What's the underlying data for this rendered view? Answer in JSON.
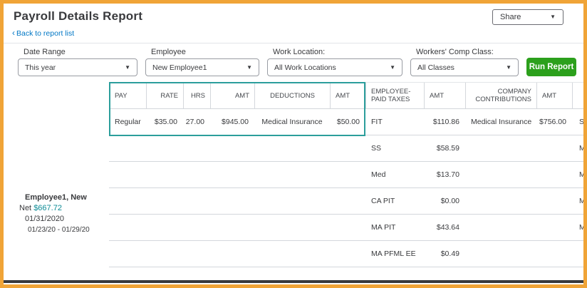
{
  "page": {
    "title": "Payroll Details Report",
    "back_link": "Back to report list",
    "share_label": "Share"
  },
  "colors": {
    "frame_border": "#F0A437",
    "link_blue": "#0077C5",
    "highlight_teal": "#2C9E9C",
    "run_report_green": "#2CA01C",
    "net_amount_teal": "#0C8B95",
    "bottom_band_dark": "#393A3D"
  },
  "filters": {
    "date_range_label": "Date Range",
    "date_range_value": "This year",
    "employee_label": "Employee",
    "employee_value": "New Employee1",
    "work_location_label": "Work Location:",
    "work_location_value": "All Work Locations",
    "workers_comp_label": "Workers' Comp Class:",
    "workers_comp_value": "All Classes",
    "run_report_label": "Run Report"
  },
  "employee": {
    "name": "Employee1, New",
    "net_label": "Net ",
    "net_amount": "$667.72",
    "pay_date": "01/31/2020",
    "pay_period": "01/23/20 -  01/29/20"
  },
  "table": {
    "headers": {
      "pay": "PAY",
      "rate": "RATE",
      "hrs": "HRS",
      "amt1": "AMT",
      "deductions": "DEDUCTIONS",
      "amt2": "AMT",
      "employee_paid_taxes": "EMPLOYEE-PAID TAXES",
      "amt3": "AMT",
      "company_contributions": "COMPANY CONTRIBUTIONS",
      "amt4": "AMT"
    },
    "rows": [
      {
        "pay": "Regular",
        "rate": "$35.00",
        "hrs": "27.00",
        "amt1": "$945.00",
        "deduction": "Medical Insurance",
        "amt2": "$50.00",
        "tax": "FIT",
        "amt3": "$110.86",
        "contribution": "Medical Insurance",
        "amt4": "$756.00",
        "clipped": "S"
      },
      {
        "tax": "SS",
        "amt3": "$58.59",
        "clipped": "M"
      },
      {
        "tax": "Med",
        "amt3": "$13.70",
        "clipped": "M"
      },
      {
        "tax": "CA PIT",
        "amt3": "$0.00",
        "clipped": "M"
      },
      {
        "tax": "MA PIT",
        "amt3": "$43.64",
        "clipped": "M"
      },
      {
        "tax": "MA PFML EE",
        "amt3": "$0.49",
        "clipped": ""
      }
    ]
  }
}
